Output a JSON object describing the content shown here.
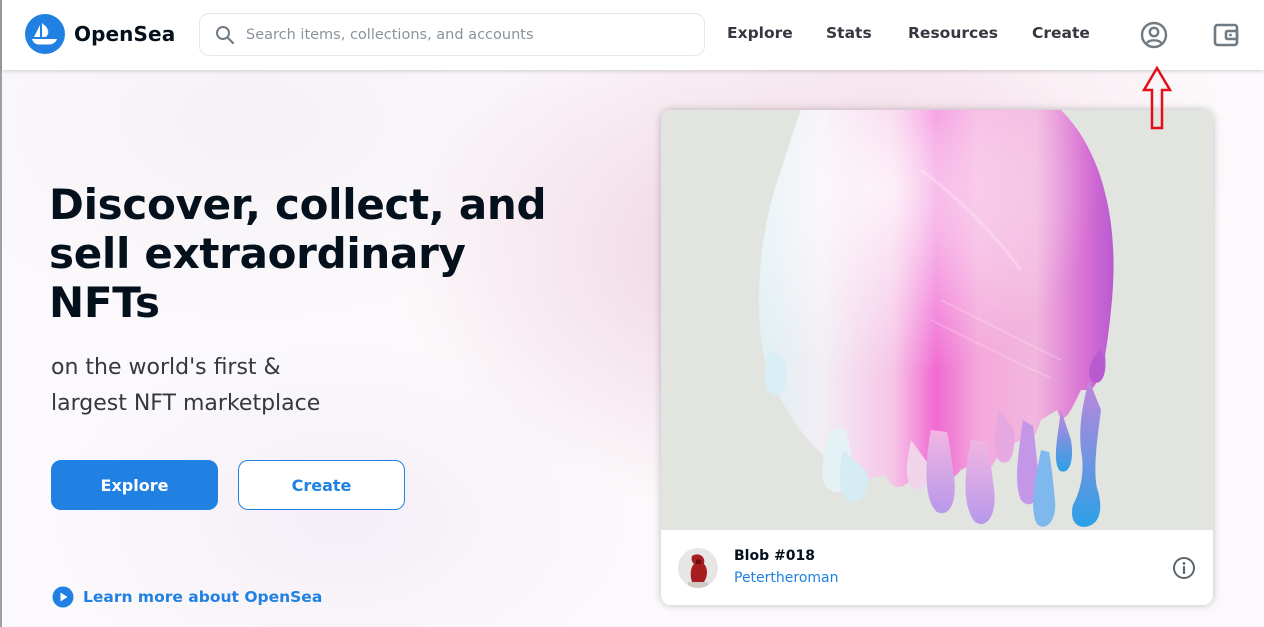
{
  "brand": {
    "name": "OpenSea",
    "color": "#2081e2"
  },
  "header": {
    "search": {
      "placeholder": "Search items, collections, and accounts",
      "value": ""
    },
    "nav": [
      {
        "label": "Explore"
      },
      {
        "label": "Stats"
      },
      {
        "label": "Resources"
      },
      {
        "label": "Create"
      }
    ],
    "icons": [
      "search-icon",
      "account-icon",
      "wallet-icon"
    ]
  },
  "hero": {
    "title_lines": [
      "Discover, collect, and",
      "sell extraordinary",
      "NFTs"
    ],
    "subtitle_lines": [
      "on the world's first &",
      "largest NFT marketplace"
    ],
    "primary_button": "Explore",
    "secondary_button": "Create",
    "learn_more": "Learn more about OpenSea"
  },
  "featured": {
    "title": "Blob #018",
    "creator": "Petertheroman"
  },
  "colors": {
    "text": "#04111d",
    "secondary_text": "#353840",
    "placeholder": "#8a939b",
    "annotation": "#e0101a"
  }
}
